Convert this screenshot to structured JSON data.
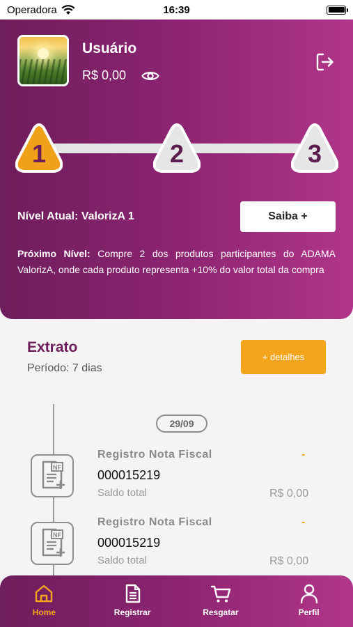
{
  "status_bar": {
    "carrier": "Operadora",
    "time": "16:39"
  },
  "header": {
    "user_name": "Usuário",
    "balance": "R$ 0,00",
    "levels": [
      "1",
      "2",
      "3"
    ],
    "active_level": 1,
    "current_level_text": "Nível Atual: ValorizA 1",
    "saiba_button": "Saiba +",
    "next_level_label": "Próximo Nível:",
    "next_level_text": "Compre 2 dos produtos participantes do ADAMA ValorizA, onde cada produto representa +10% do valor total da compra"
  },
  "extrato": {
    "title": "Extrato",
    "period": "Período: 7 dias",
    "details_button": "+ detalhes",
    "date": "29/09",
    "entries": [
      {
        "title": "Registro Nota Fiscal",
        "dash": "-",
        "number": "000015219",
        "label": "Saldo total",
        "value": "R$ 0,00"
      },
      {
        "title": "Registro Nota Fiscal",
        "dash": "-",
        "number": "000015219",
        "label": "Saldo total",
        "value": "R$ 0,00"
      }
    ]
  },
  "nav": [
    {
      "label": "Home",
      "icon": "home-icon"
    },
    {
      "label": "Registrar",
      "icon": "document-icon"
    },
    {
      "label": "Resgatar",
      "icon": "cart-icon"
    },
    {
      "label": "Perfil",
      "icon": "user-icon"
    }
  ],
  "colors": {
    "primary": "#8c2472",
    "accent": "#f5a51c"
  }
}
